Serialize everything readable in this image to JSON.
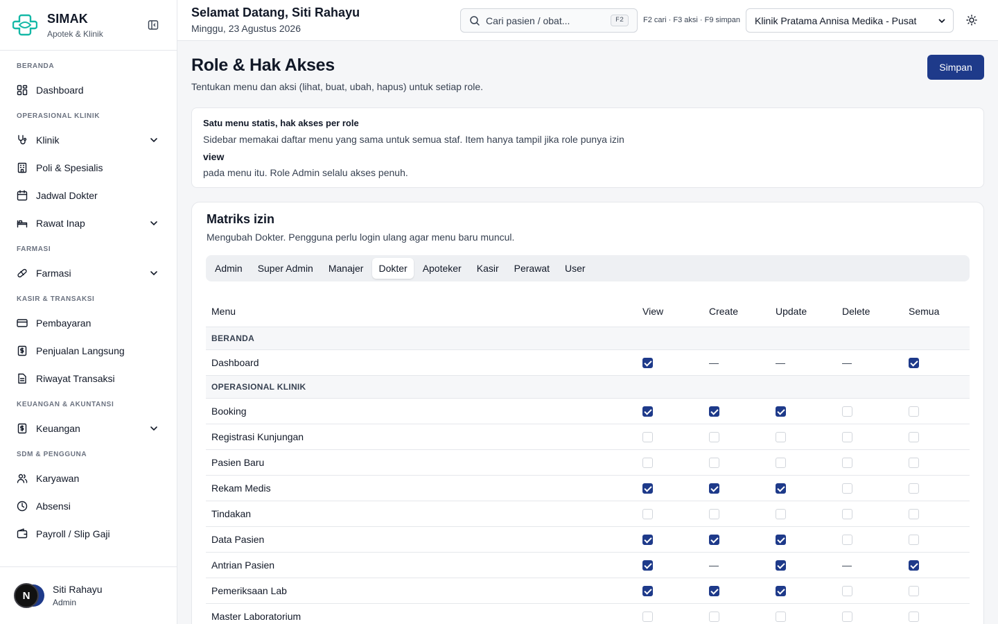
{
  "app": {
    "name": "SIMAK",
    "subtitle": "Apotek & Klinik"
  },
  "sidebar": {
    "sections": [
      {
        "title": "BERANDA",
        "items": [
          {
            "label": "Dashboard",
            "icon": "dashboard-icon",
            "expandable": false
          }
        ]
      },
      {
        "title": "OPERASIONAL KLINIK",
        "items": [
          {
            "label": "Klinik",
            "icon": "stethoscope-icon",
            "expandable": true
          },
          {
            "label": "Poli & Spesialis",
            "icon": "building-icon",
            "expandable": false
          },
          {
            "label": "Jadwal Dokter",
            "icon": "calendar-icon",
            "expandable": false
          },
          {
            "label": "Rawat Inap",
            "icon": "bed-icon",
            "expandable": true
          }
        ]
      },
      {
        "title": "FARMASI",
        "items": [
          {
            "label": "Farmasi",
            "icon": "pill-icon",
            "expandable": true
          }
        ]
      },
      {
        "title": "KASIR & TRANSAKSI",
        "items": [
          {
            "label": "Pembayaran",
            "icon": "credit-card-icon",
            "expandable": false
          },
          {
            "label": "Penjualan Langsung",
            "icon": "receipt-icon",
            "expandable": false
          },
          {
            "label": "Riwayat Transaksi",
            "icon": "file-icon",
            "expandable": false
          }
        ]
      },
      {
        "title": "KEUANGAN & AKUNTANSI",
        "items": [
          {
            "label": "Keuangan",
            "icon": "receipt-icon",
            "expandable": true
          }
        ]
      },
      {
        "title": "SDM & PENGGUNA",
        "items": [
          {
            "label": "Karyawan",
            "icon": "users-icon",
            "expandable": false
          },
          {
            "label": "Absensi",
            "icon": "clock-icon",
            "expandable": false
          },
          {
            "label": "Payroll / Slip Gaji",
            "icon": "wallet-icon",
            "expandable": false
          }
        ]
      }
    ]
  },
  "user": {
    "name": "Siti Rahayu",
    "role": "Admin",
    "initial": "N"
  },
  "topbar": {
    "greeting": "Selamat Datang, Siti Rahayu",
    "date": "Minggu, 23 Agustus 2026",
    "search_placeholder": "Cari pasien / obat...",
    "search_key": "F2",
    "shortcuts": "F2 cari · F3 aksi · F9 simpan",
    "clinic": "Klinik Pratama Annisa Medika - Pusat"
  },
  "page": {
    "title": "Role & Hak Akses",
    "description": "Tentukan menu dan aksi (lihat, buat, ubah, hapus) untuk setiap role.",
    "save_label": "Simpan"
  },
  "info": {
    "title": "Satu menu statis, hak akses per role",
    "line1": "Sidebar memakai daftar menu yang sama untuk semua staf. Item hanya tampil jika role punya izin",
    "strong": "view",
    "line2": "pada menu itu. Role Admin selalu akses penuh."
  },
  "matrix": {
    "title": "Matriks izin",
    "description": "Mengubah Dokter. Pengguna perlu login ulang agar menu baru muncul.",
    "tabs": [
      "Admin",
      "Super Admin",
      "Manajer",
      "Dokter",
      "Apoteker",
      "Kasir",
      "Perawat",
      "User"
    ],
    "active_tab": "Dokter",
    "columns": [
      "Menu",
      "View",
      "Create",
      "Update",
      "Delete",
      "Semua"
    ],
    "rows": [
      {
        "group": "BERANDA"
      },
      {
        "menu": "Dashboard",
        "perms": [
          "on",
          "na",
          "na",
          "na",
          "on"
        ]
      },
      {
        "group": "OPERASIONAL KLINIK"
      },
      {
        "menu": "Booking",
        "perms": [
          "on",
          "on",
          "on",
          "off",
          "off"
        ]
      },
      {
        "menu": "Registrasi Kunjungan",
        "perms": [
          "off",
          "off",
          "off",
          "off",
          "off"
        ]
      },
      {
        "menu": "Pasien Baru",
        "perms": [
          "off",
          "off",
          "off",
          "off",
          "off"
        ]
      },
      {
        "menu": "Rekam Medis",
        "perms": [
          "on",
          "on",
          "on",
          "off",
          "off"
        ]
      },
      {
        "menu": "Tindakan",
        "perms": [
          "off",
          "off",
          "off",
          "off",
          "off"
        ]
      },
      {
        "menu": "Data Pasien",
        "perms": [
          "on",
          "on",
          "on",
          "off",
          "off"
        ]
      },
      {
        "menu": "Antrian Pasien",
        "perms": [
          "on",
          "na",
          "on",
          "na",
          "on"
        ]
      },
      {
        "menu": "Pemeriksaan Lab",
        "perms": [
          "on",
          "on",
          "on",
          "off",
          "off"
        ]
      },
      {
        "menu": "Master Laboratorium",
        "perms": [
          "off",
          "off",
          "off",
          "off",
          "off"
        ]
      }
    ]
  },
  "colors": {
    "primary": "#1e3a8a",
    "brand": "#14b8a6",
    "border": "#e5e7eb"
  }
}
